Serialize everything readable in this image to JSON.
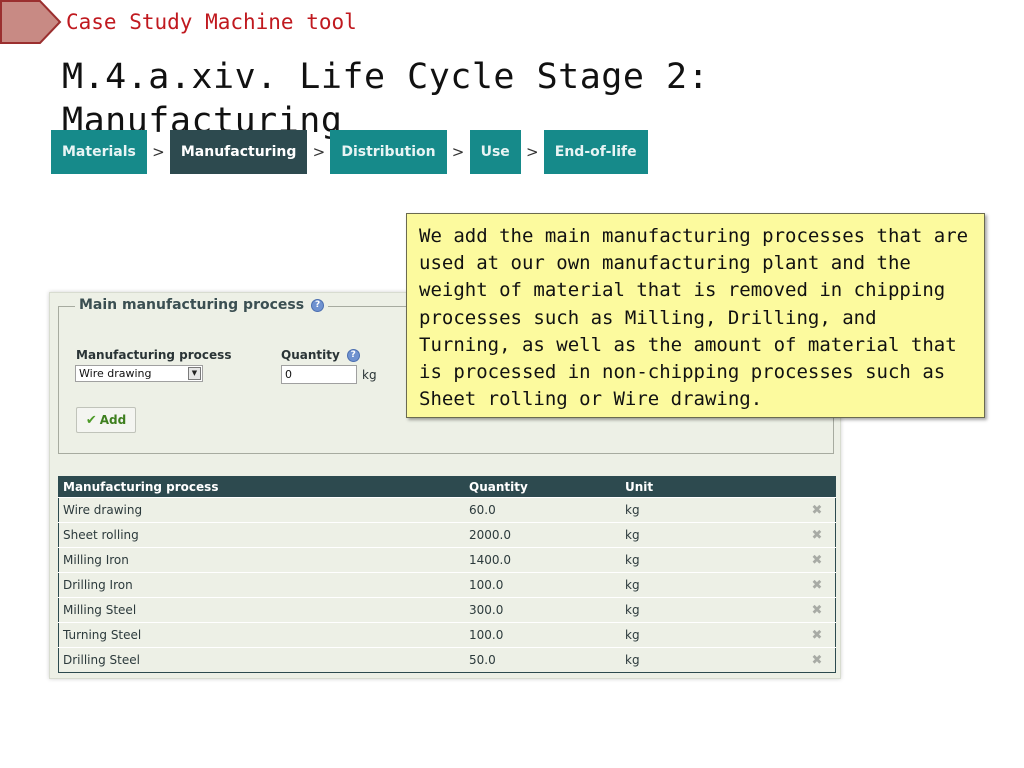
{
  "slide": {
    "subtitle": "Case Study Machine tool",
    "title": "M.4.a.xiv. Life Cycle Stage 2: Manufacturing"
  },
  "stages": [
    {
      "label": "Materials",
      "active": false
    },
    {
      "label": "Manufacturing",
      "active": true
    },
    {
      "label": "Distribution",
      "active": false
    },
    {
      "label": "Use",
      "active": false
    },
    {
      "label": "End-of-life",
      "active": false
    }
  ],
  "stage_separator": ">",
  "form": {
    "legend": "Main manufacturing process",
    "process_label": "Manufacturing process",
    "quantity_label": "Quantity",
    "process_value": "Wire drawing",
    "quantity_value": "0",
    "unit": "kg",
    "add_label": "Add"
  },
  "table": {
    "headers": {
      "process": "Manufacturing process",
      "quantity": "Quantity",
      "unit": "Unit"
    },
    "rows": [
      {
        "process": "Wire drawing",
        "quantity": "60.0",
        "unit": "kg"
      },
      {
        "process": "Sheet rolling",
        "quantity": "2000.0",
        "unit": "kg"
      },
      {
        "process": "Milling Iron",
        "quantity": "1400.0",
        "unit": "kg"
      },
      {
        "process": "Drilling Iron",
        "quantity": "100.0",
        "unit": "kg"
      },
      {
        "process": "Milling Steel",
        "quantity": "300.0",
        "unit": "kg"
      },
      {
        "process": "Turning Steel",
        "quantity": "100.0",
        "unit": "kg"
      },
      {
        "process": "Drilling Steel",
        "quantity": "50.0",
        "unit": "kg"
      }
    ],
    "delete_icon": "✖"
  },
  "callout": {
    "text": "We add the main manufacturing processes that are used at our own manufacturing plant and the weight of material that is removed in chipping processes such as Milling, Drilling, and Turning, as well as the amount of material that is processed in non-chipping processes such as Sheet rolling or Wire drawing."
  },
  "colors": {
    "accent_teal": "#168a8a",
    "dark_teal": "#2d4a4f",
    "subtitle_red": "#c0191f",
    "callout_yellow": "#fcfa9e"
  }
}
